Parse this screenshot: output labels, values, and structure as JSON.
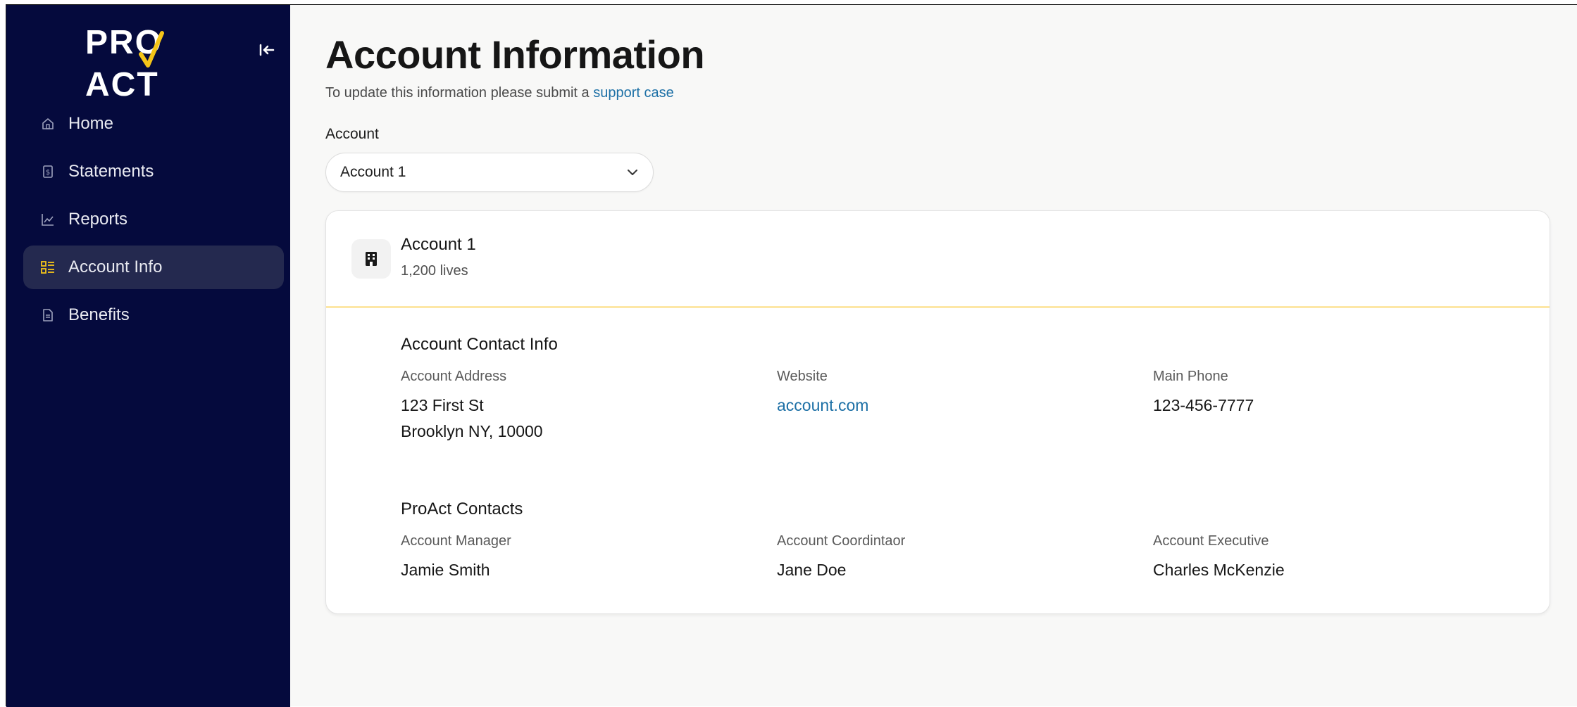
{
  "sidebar": {
    "logo": "PRO✓ACT",
    "items": [
      {
        "label": "Home",
        "icon": "home-icon"
      },
      {
        "label": "Statements",
        "icon": "statement-icon"
      },
      {
        "label": "Reports",
        "icon": "chart-icon"
      },
      {
        "label": "Account Info",
        "icon": "account-info-icon",
        "active": true
      },
      {
        "label": "Benefits",
        "icon": "document-icon"
      }
    ]
  },
  "header": {
    "title": "Account Information",
    "subtitle_prefix": "To update this information please submit a ",
    "subtitle_link": "support case"
  },
  "account_select": {
    "label": "Account",
    "value": "Account 1"
  },
  "card": {
    "name": "Account 1",
    "lives": "1,200 lives",
    "contact_section": {
      "title": "Account Contact Info",
      "address_label": "Account Address",
      "address_line1": "123 First St",
      "address_line2": "Brooklyn NY, 10000",
      "website_label": "Website",
      "website_value": "account.com",
      "phone_label": "Main Phone",
      "phone_value": "123-456-7777"
    },
    "proact_section": {
      "title": "ProAct  Contacts",
      "manager_label": "Account Manager",
      "manager_value": "Jamie Smith",
      "coordinator_label": "Account Coordintaor",
      "coordinator_value": "Jane Doe",
      "executive_label": "Account Executive",
      "executive_value": "Charles McKenzie"
    }
  },
  "colors": {
    "sidebar_bg": "#050a3d",
    "active_item_bg": "#24294f",
    "accent_yellow": "#f5c518",
    "link": "#1d70a6",
    "divider": "#fde7a6"
  }
}
